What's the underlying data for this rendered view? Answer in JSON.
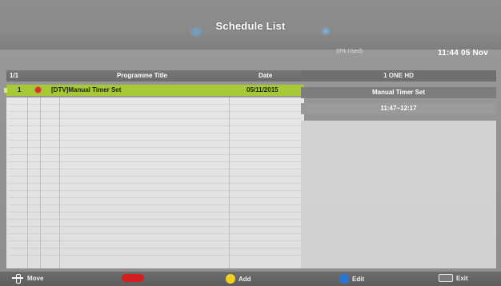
{
  "header": {
    "title": "Schedule List",
    "used": "(0% Used)",
    "time": "11:44 05 Nov"
  },
  "table": {
    "headers": {
      "num": "1/1",
      "title": "Programme Title",
      "date": "Date"
    },
    "rows": [
      {
        "num": "1",
        "title": "[DTV]Manual Timer Set",
        "date": "05/11/2015"
      }
    ]
  },
  "right_panel": {
    "channel": "1 ONE HD",
    "timer": "Manual Timer Set",
    "time_range": "11:47~12:17"
  },
  "footer": {
    "move": "Move",
    "add": "Add",
    "edit": "Edit",
    "exit": "Exit"
  },
  "icons": {
    "move": "move-arrows-icon",
    "delete": "red-button-icon",
    "add": "yellow-button-icon",
    "edit": "blue-button-icon",
    "exit": "exit-key-icon"
  },
  "colors": {
    "selected_row": "#a7c936",
    "delete": "#d31f1f",
    "add": "#f2cf1c",
    "edit": "#2a76d8"
  }
}
